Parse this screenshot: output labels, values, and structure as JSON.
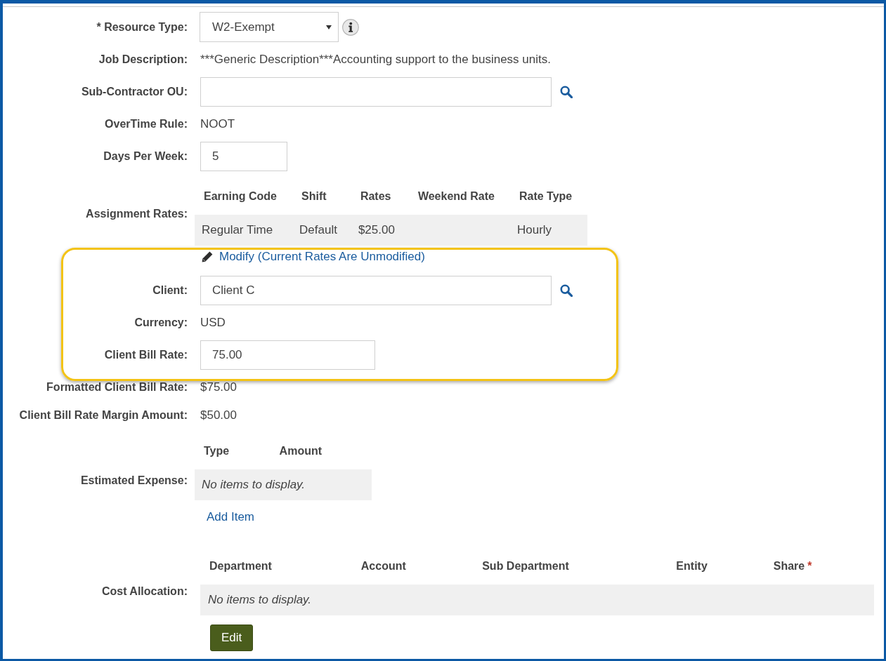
{
  "form": {
    "rows": [
      {
        "kind": "select",
        "label": "* Resource Type:",
        "value": "W2-Exempt",
        "info": true
      },
      {
        "kind": "text",
        "label": "Job Description:",
        "value": "***Generic Description***Accounting support to the business units."
      },
      {
        "kind": "lookup",
        "label": "Sub-Contractor OU:",
        "lookup": true
      },
      {
        "kind": "text",
        "label": "OverTime Rule:",
        "value": "NOOT"
      },
      {
        "kind": "number",
        "label": "Days Per Week:",
        "value": "5"
      },
      {
        "kind": "table",
        "label": "Assignment Rates:",
        "columns": [
          {
            "label": "Earning Code"
          },
          {
            "label": "Shift"
          },
          {
            "label": "Rates"
          },
          {
            "label": "Weekend Rate"
          },
          {
            "label": "Rate Type"
          }
        ],
        "rows": [
          [
            "Regular Time",
            "Default",
            "$25.00",
            null,
            "Hourly"
          ]
        ]
      },
      {
        "kind": "group",
        "highlighted": true,
        "rows": [
          {
            "kind": "link",
            "value": "Modify (Current Rates Are Unmodified)"
          },
          {
            "kind": "lookup",
            "label": "Client:",
            "value": "Client C",
            "lookup": true
          },
          {
            "kind": "text",
            "label": "Currency:",
            "value": "USD"
          },
          {
            "kind": "amount",
            "label": "Client Bill Rate:",
            "value": "75.00"
          }
        ]
      },
      {
        "kind": "text",
        "label": "Formatted Client Bill Rate:",
        "value": "$75.00"
      },
      {
        "kind": "text",
        "label": "Client Bill Rate Margin Amount:",
        "value": "$50.00"
      },
      {
        "kind": "table",
        "label": "Estimated Expense:",
        "columns": [
          {
            "label": "Type"
          },
          {
            "label": "Amount"
          }
        ],
        "empty": "No items to display.",
        "action": {
          "kind": "link",
          "label": "Add Item"
        }
      },
      {
        "kind": "grid",
        "label": "Cost Allocation:",
        "columns": [
          {
            "label": "Department"
          },
          {
            "label": "Account"
          },
          {
            "label": "Sub Department"
          },
          {
            "label": "Entity"
          },
          {
            "label": "Share",
            "mark": "*"
          }
        ],
        "empty": "No items to display.",
        "action": {
          "kind": "button",
          "label": "Edit"
        }
      }
    ]
  }
}
